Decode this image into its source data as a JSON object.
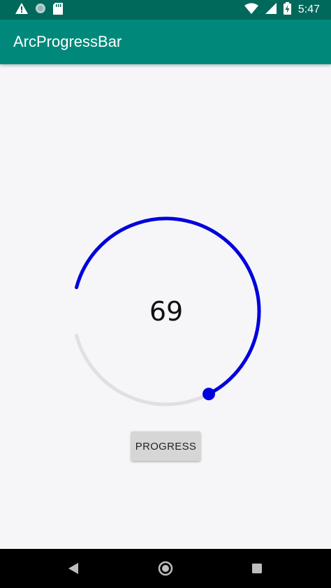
{
  "status_bar": {
    "time": "5:47",
    "icons": [
      "warning-icon",
      "circle-notification-icon",
      "sd-card-icon",
      "wifi-icon",
      "cellular-signal-icon",
      "battery-charging-icon"
    ]
  },
  "app_bar": {
    "title": "ArcProgressBar"
  },
  "arc_progress": {
    "value": "69",
    "progress_color": "#0000dd",
    "track_color": "#e0e0e0",
    "knob_color": "#0000dd"
  },
  "progress_button": {
    "label": "PROGRESS"
  },
  "nav_bar": {
    "icons": [
      "back-icon",
      "home-icon",
      "recents-icon"
    ]
  },
  "colors": {
    "status_bar": "#00695c",
    "app_bar": "#00897b",
    "background": "#f6f6f8"
  }
}
